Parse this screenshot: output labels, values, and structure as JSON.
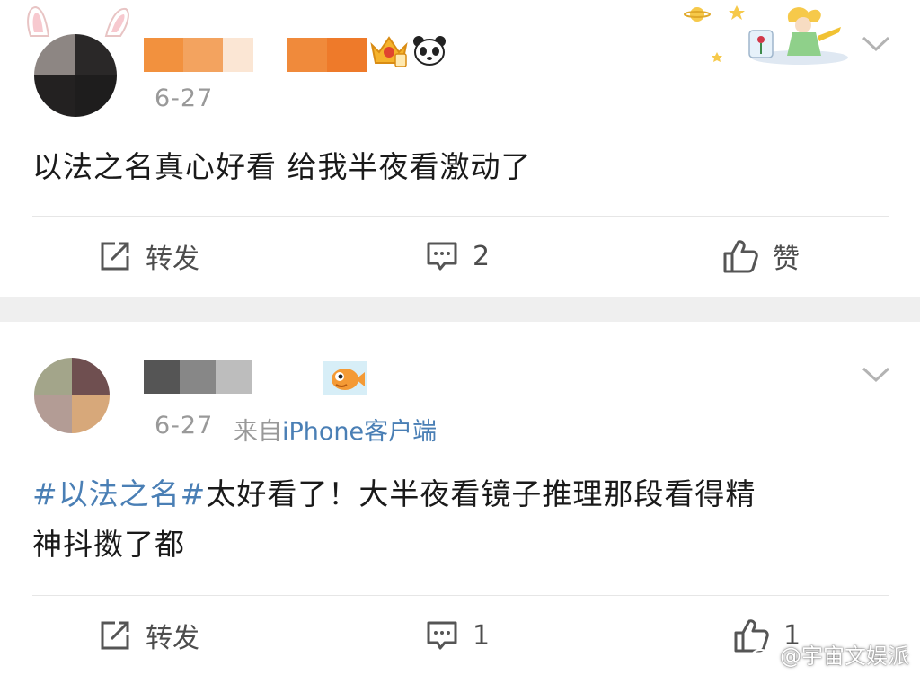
{
  "posts": [
    {
      "date": "6-27",
      "source_prefix": "",
      "source_device": "",
      "text": "以法之名真心好看 给我半夜看激动了",
      "actions": {
        "repost_label": "转发",
        "comment_count": "2",
        "like_label": "赞"
      }
    },
    {
      "date": "6-27",
      "source_prefix": "来自",
      "source_device": "iPhone客户端",
      "hashtag": "#以法之名#",
      "text": "太好看了！大半夜看镜子推理那段看得精",
      "text_line2": "神抖擞了都",
      "actions": {
        "repost_label": "转发",
        "comment_count": "1",
        "like_count": "1"
      }
    }
  ],
  "watermark": "@宇宙文娱派",
  "colors": {
    "link": "#4a7fb5",
    "meta": "#999999",
    "divider": "#e6e6e6",
    "separator": "#efefef"
  },
  "icons": [
    "repost-icon",
    "comment-icon",
    "like-icon",
    "chevron-down-icon",
    "crown-badge-icon",
    "panda-icon",
    "fish-icon",
    "bunny-ears-icon",
    "little-prince-decoration"
  ]
}
